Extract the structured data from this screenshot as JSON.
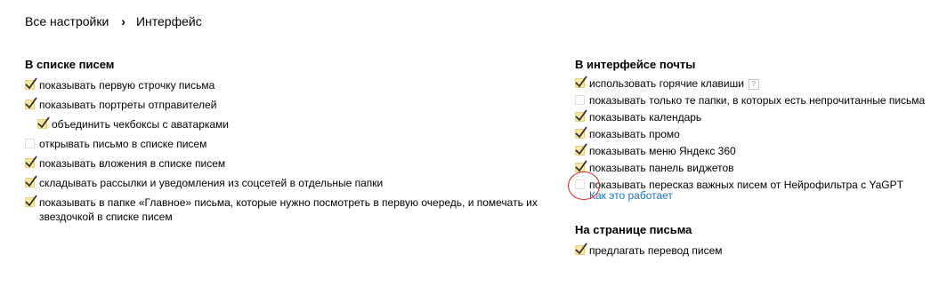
{
  "breadcrumb": {
    "root": "Все настройки",
    "separator": "›",
    "current": "Интерфейс"
  },
  "left": {
    "title": "В списке писем",
    "options": [
      {
        "label": "показывать первую строчку письма",
        "checked": true,
        "sub": false
      },
      {
        "label": "показывать портреты отправителей",
        "checked": true,
        "sub": false
      },
      {
        "label": "объединить чекбоксы с аватарками",
        "checked": true,
        "sub": true
      },
      {
        "label": "открывать письмо в списке писем",
        "checked": false,
        "sub": false
      },
      {
        "label": "показывать вложения в списке писем",
        "checked": true,
        "sub": false
      },
      {
        "label": "складывать рассылки и уведомления из соцсетей в отдельные папки",
        "checked": true,
        "sub": false
      },
      {
        "label": "показывать в папке «Главное» письма, которые нужно посмотреть в первую очередь, и помечать их звездочкой в списке писем",
        "checked": true,
        "sub": false
      }
    ]
  },
  "right": {
    "title": "В интерфейсе почты",
    "options": [
      {
        "label": "использовать горячие клавиши",
        "checked": true,
        "help": "?"
      },
      {
        "label": "показывать только те папки, в которых есть непрочитанные письма",
        "checked": false
      },
      {
        "label": "показывать календарь",
        "checked": true
      },
      {
        "label": "показывать промо",
        "checked": true
      },
      {
        "label": "показывать меню Яндекс 360",
        "checked": true
      },
      {
        "label": "показывать панель виджетов",
        "checked": true
      },
      {
        "label": "показывать пересказ важных писем от Нейрофильтра с YaGPT",
        "checked": false,
        "highlighted": true,
        "link": "Как это работает"
      }
    ]
  },
  "letter_page": {
    "title": "На странице письма",
    "options": [
      {
        "label": "предлагать перевод писем",
        "checked": true
      }
    ]
  },
  "colors": {
    "check": "#2a2a2a",
    "checkbox_fill": "#f6e7a9",
    "link": "#1a73c9",
    "highlight_circle": "#d7262f"
  },
  "icons": {
    "checkmark": "check-icon",
    "help": "help-icon"
  }
}
